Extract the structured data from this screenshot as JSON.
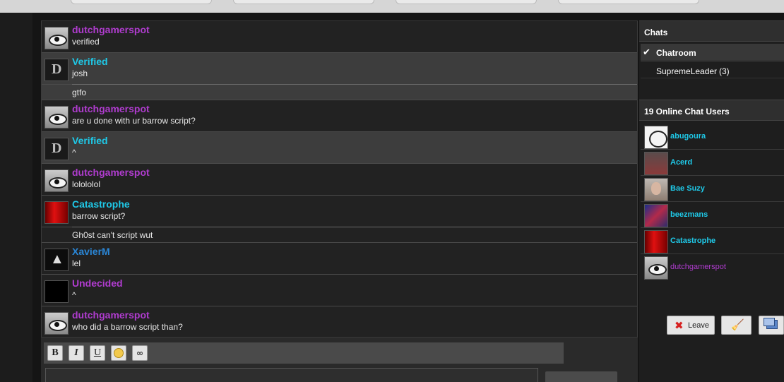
{
  "messages": [
    {
      "user": "dutchgamerspot",
      "color": "purple",
      "avatar": "eye-avatar",
      "lines": [
        "verified"
      ],
      "alt": false
    },
    {
      "user": "Verified",
      "color": "cyan",
      "avatar": "verified-avatar",
      "lines": [
        "josh",
        "gtfo"
      ],
      "alt": true
    },
    {
      "user": "dutchgamerspot",
      "color": "purple",
      "avatar": "eye-avatar",
      "lines": [
        "are u done with ur barrow script?"
      ],
      "alt": false
    },
    {
      "user": "Verified",
      "color": "cyan",
      "avatar": "verified-avatar",
      "lines": [
        "^"
      ],
      "alt": true
    },
    {
      "user": "dutchgamerspot",
      "color": "purple",
      "avatar": "eye-avatar",
      "lines": [
        "lolololol"
      ],
      "alt": false
    },
    {
      "user": "Catastrophe",
      "color": "cyan",
      "avatar": "red-avatar",
      "lines": [
        "barrow script?",
        "Gh0st can't script wut"
      ],
      "alt": false
    },
    {
      "user": "XavierM",
      "color": "blue",
      "avatar": "dark-avatar",
      "lines": [
        "lel"
      ],
      "alt": false
    },
    {
      "user": "Undecided",
      "color": "purple",
      "avatar": "undecided-avatar",
      "lines": [
        "^"
      ],
      "alt": false
    },
    {
      "user": "dutchgamerspot",
      "color": "purple",
      "avatar": "eye-avatar",
      "lines": [
        "who did a barrow script than?"
      ],
      "alt": false
    }
  ],
  "toolbar": {
    "bold": "B",
    "italic": "I",
    "underline": "U",
    "smiley_icon": "smiley-icon",
    "link_icon": "link-icon"
  },
  "sidebar": {
    "chats_title": "Chats",
    "chats": [
      {
        "label": "Chatroom",
        "count": "",
        "active": true
      },
      {
        "label": "SupremeLeader",
        "count": "(3)",
        "active": false
      }
    ],
    "online_title": "19 Online Chat Users",
    "users": [
      {
        "name": "abugoura",
        "color": "cyan",
        "avatar": "troll-avatar",
        "bold": true
      },
      {
        "name": "Acerd",
        "color": "cyan",
        "avatar": "acerd-avatar",
        "bold": true
      },
      {
        "name": "Bae Suzy",
        "color": "cyan",
        "avatar": "bae-avatar",
        "bold": true
      },
      {
        "name": "beezmans",
        "color": "cyan",
        "avatar": "beez-avatar",
        "bold": true
      },
      {
        "name": "Catastrophe",
        "color": "cyan",
        "avatar": "red-avatar",
        "bold": true
      },
      {
        "name": "dutchgamerspot",
        "color": "purple",
        "avatar": "eye-avatar",
        "bold": false
      }
    ],
    "leave_label": "Leave"
  },
  "colors": {
    "purple": "#b03ccf",
    "cyan": "#1fc9e8",
    "blue": "#2a86d6"
  }
}
